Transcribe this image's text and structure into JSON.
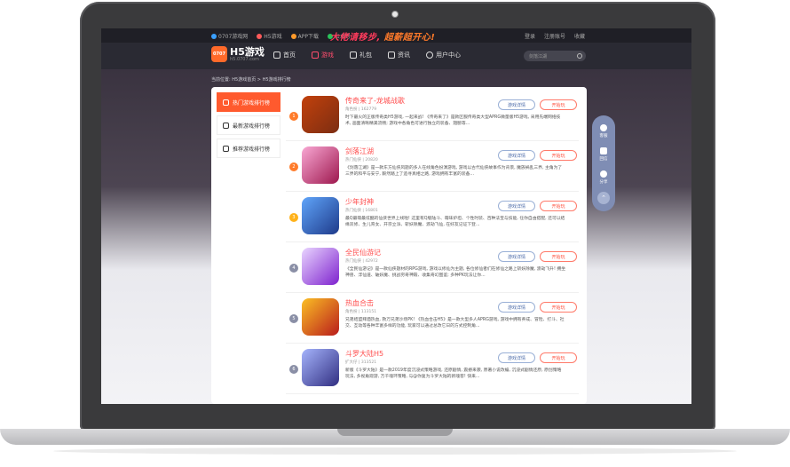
{
  "topbar": {
    "links": [
      "0707游戏网",
      "H5游戏",
      "APP下载",
      "公众号"
    ],
    "promo_a": "大佬请移步,",
    "promo_b": "超薪超开心!",
    "right": [
      "登录",
      "注册账号",
      "收藏"
    ]
  },
  "header": {
    "logo_badge": "0707",
    "logo_text": "H5游戏",
    "logo_sub": "h5.0707.com",
    "nav": [
      "首页",
      "游戏",
      "礼包",
      "资讯",
      "用户中心"
    ],
    "search_placeholder": "剑落江湖"
  },
  "breadcrumb": "当前位置: H5游戏首页 > H5游戏排行榜",
  "sidebar": [
    {
      "label": "热门游戏排行榜",
      "active": true
    },
    {
      "label": "最新游戏排行榜",
      "active": false
    },
    {
      "label": "推荐游戏排行榜",
      "active": false
    }
  ],
  "buttons": {
    "detail": "游戏详情",
    "play": "开始玩"
  },
  "games": [
    {
      "rank": "1",
      "name": "传奇来了-龙城战歌",
      "meta": "角色扮 | 162779",
      "desc": "时下最火的正版传奇类H5游戏, 一起来战! 《传奇来了》是款区服传奇类大型APRG微量版H5游戏, 采用先端网络技术, 画面清晰精美流畅; 游戏中各角色可进行独立的装备、翅膀等...",
      "color": "#ff7b2a"
    },
    {
      "rank": "2",
      "name": "剑落江湖",
      "meta": "热门仙侠 | 20820",
      "desc": "《剑落江湖》是一款东方仙侠风题的多人在线角色扮演游戏, 游戏以古代仙侠故事作为背景, 魔族祸乱三界, 主角为了三界的和平与安宁, 毅然踏上了追寻真相之路, 游戏拥有丰富的装备...",
      "color": "#ff7b2a"
    },
    {
      "rank": "3",
      "name": "少年封神",
      "meta": "热门仙侠 | 16801",
      "desc": "最Q最萌最炫酷的仙侠世界上线啦! 这里有Q版陆斗、萌味炉坦、个性时装、百种法宝与技能, 任你自由搭配, 还可以结缘双修、生儿育女、开宗立派、斩妖除魔、渡劫飞仙, 在好友记证下登...",
      "color": "#ffb21a"
    },
    {
      "rank": "4",
      "name": "全民仙游记",
      "meta": "热门仙侠 | 42972",
      "desc": "《全民仙游记》是一款仙侠题材的RPG游戏, 游戏以修仙为主题, 各位修仙者们在修仙之路上斩妖除魔, 渡劫飞升! 拥坐神兽、浮仙道、破妖魔、挑战穷奇神殿、收集奇幻图鉴; 多种PK玩法让你...",
      "color": "#8a8fa6"
    },
    {
      "rank": "5",
      "name": "热血合击",
      "meta": "角色扮 | 113151",
      "desc": "兄弟结盟拜酒热血, 救万兄弟沙场PK! 《热血合击H5》是一款大型多人APRG游戏, 游戏中拥有养成、冒险、打斗、社交、互动等各种丰富多样的功能, 玩家可以通过总改它日的方式控制角...",
      "color": "#8a8fa6"
    },
    {
      "rank": "6",
      "name": "斗罗大陆H5",
      "meta": "扩大仔 | 313521",
      "desc": "新版《斗罗大陆》是一款2019年度沉浸式策略游戏, 还原剧情, 震撼来袭, 原著小说改编, 沉浸式剧情还原, 原创策略玩法, 多视角观游, 万千魂环策略, 与@你复为斗罗大陆的新魂客! 快来...",
      "color": "#8a8fa6"
    }
  ],
  "tools": [
    "客服",
    "回信",
    "分享"
  ]
}
